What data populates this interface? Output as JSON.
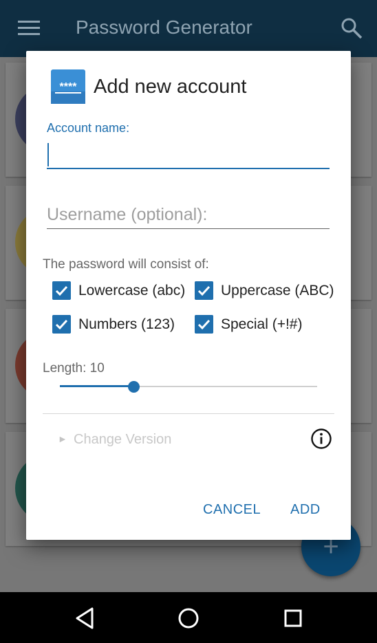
{
  "app": {
    "title": "Password Generator",
    "menu_icon": "menu-icon",
    "search_icon": "search-icon",
    "fab_icon": "+"
  },
  "dialog": {
    "icon": "password-stars-icon",
    "icon_text": "****",
    "title": "Add new account",
    "account_name_label": "Account name:",
    "account_name_value": "",
    "username_placeholder": "Username (optional):",
    "username_value": "",
    "consist_label": "The password will consist of:",
    "options": [
      {
        "label": "Lowercase (abc)",
        "checked": true
      },
      {
        "label": "Uppercase (ABC)",
        "checked": true
      },
      {
        "label": "Numbers (123)",
        "checked": true
      },
      {
        "label": "Special (+!#)",
        "checked": true
      }
    ],
    "length_label": "Length: 10",
    "length_fraction": 0.285,
    "change_version_arrow": "►",
    "change_version_label": "Change Version",
    "info_icon": "info-icon",
    "cancel_label": "CANCEL",
    "add_label": "ADD"
  },
  "navbar": {
    "back_icon": "back-triangle-icon",
    "home_icon": "home-circle-icon",
    "recents_icon": "recents-square-icon"
  },
  "colors": {
    "accent": "#1f6fae",
    "appbar": "#0f2e42"
  }
}
